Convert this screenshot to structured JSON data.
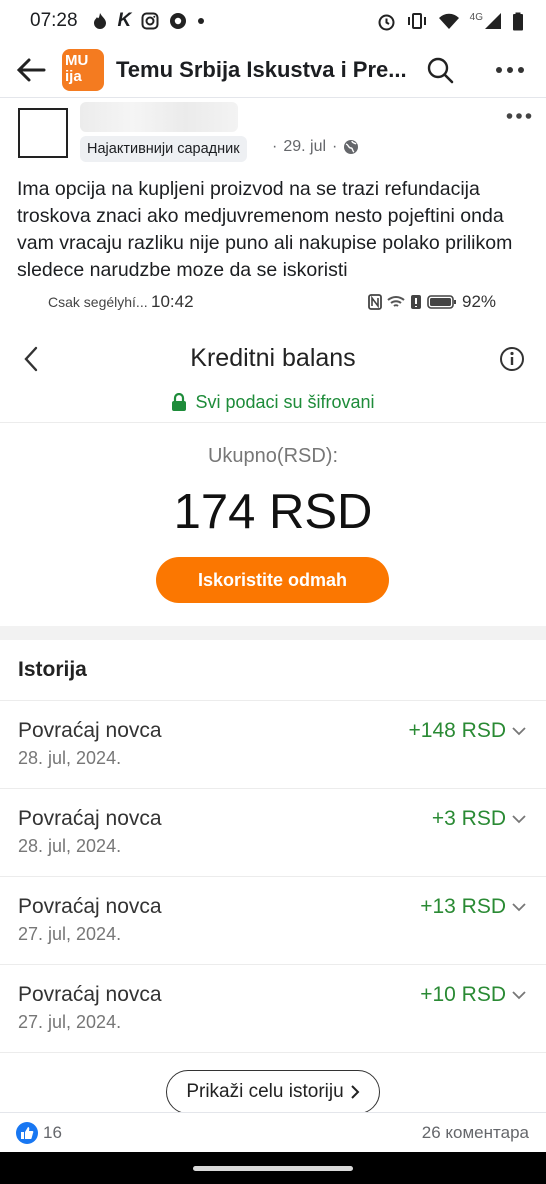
{
  "status_bar": {
    "time": "07:28",
    "network": "4G"
  },
  "header": {
    "group_title": "Temu Srbija Iskustva i Pre...",
    "logo_text": "MU\nija"
  },
  "post": {
    "badge": "Најактивнији сарадник",
    "date": "29. jul",
    "text": "Ima opcija na kupljeni proizvod na se trazi refundacija troskova znaci ako medjuvremenom nesto pojeftini onda vam vracaju razliku nije puno ali nakupise polako prilikom sledece narudzbe moze da se iskoristi"
  },
  "screenshot": {
    "status": {
      "left": "Csak segélyhí...",
      "time": "10:42",
      "battery": "92%"
    },
    "title": "Kreditni balans",
    "encrypted": "Svi podaci su šifrovani",
    "total_label": "Ukupno(RSD):",
    "total_value": "174 RSD",
    "use_button": "Iskoristite odmah",
    "history_title": "Istorija",
    "history": [
      {
        "label": "Povraćaj novca",
        "date": "28. jul, 2024.",
        "amount": "+148 RSD"
      },
      {
        "label": "Povraćaj novca",
        "date": "28. jul, 2024.",
        "amount": "+3 RSD"
      },
      {
        "label": "Povraćaj novca",
        "date": "27. jul, 2024.",
        "amount": "+13 RSD"
      },
      {
        "label": "Povraćaj novca",
        "date": "27. jul, 2024.",
        "amount": "+10 RSD"
      }
    ],
    "show_all": "Prikaži celu istoriju"
  },
  "reactions": {
    "likes": "16",
    "comments": "26 коментара"
  },
  "colors": {
    "accent_orange": "#fb7701",
    "positive_green": "#2a8a34",
    "fb_blue": "#1877f2"
  }
}
